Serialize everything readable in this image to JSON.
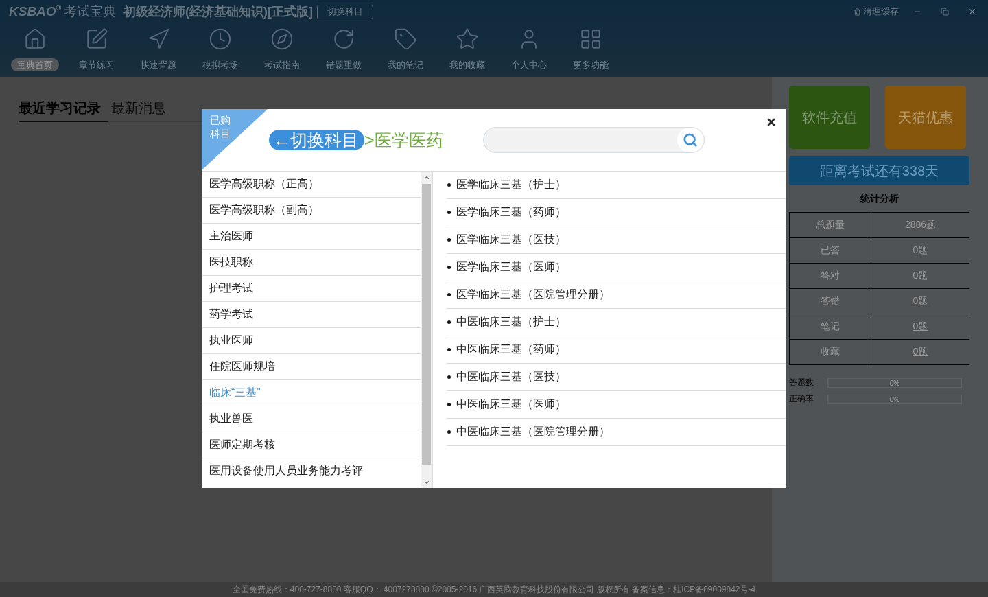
{
  "window": {
    "logo": "KSBAO$^{®}$",
    "brand": "考试宝典",
    "title": "初级经济师(经济基础知识)[正式版]",
    "switch_button": "切换科目",
    "clear_cache": "清理缓存"
  },
  "nav": [
    {
      "label": "宝典首页",
      "selected": true
    },
    {
      "label": "章节练习",
      "selected": false
    },
    {
      "label": "快速背题",
      "selected": false
    },
    {
      "label": "模拟考场",
      "selected": false
    },
    {
      "label": "考试指南",
      "selected": false
    },
    {
      "label": "错题重做",
      "selected": false
    },
    {
      "label": "我的笔记",
      "selected": false
    },
    {
      "label": "我的收藏",
      "selected": false
    },
    {
      "label": "个人中心",
      "selected": false
    },
    {
      "label": "更多功能",
      "selected": false
    }
  ],
  "main_tabs": [
    {
      "label": "最近学习记录",
      "selected": true
    },
    {
      "label": "最新消息",
      "selected": false
    }
  ],
  "side_panel": {
    "actions": [
      {
        "label": "软件充值",
        "color": "#2c5512"
      },
      {
        "label": "天猫优惠",
        "color": "#85560b"
      }
    ],
    "countdown": "距离考试还有338天",
    "stats_title": "统计分析",
    "stats": [
      {
        "label": "总题量",
        "value": "2886题",
        "link": false
      },
      {
        "label": "已答",
        "value": "0题",
        "link": false
      },
      {
        "label": "答对",
        "value": "0题",
        "link": false
      },
      {
        "label": "答错",
        "value": "0题",
        "link": true
      },
      {
        "label": "笔记",
        "value": "0题",
        "link": true
      },
      {
        "label": "收藏",
        "value": "0题",
        "link": true
      }
    ],
    "progress": [
      {
        "label": "答题数",
        "level": 0,
        "reading": "0%"
      },
      {
        "label": "正确率",
        "level": 0,
        "reading": "0%"
      }
    ]
  },
  "dialog": {
    "badge": "已购科目",
    "back_button": "←切换科目",
    "category": ">医学医药",
    "categories": [
      {
        "label": "医学高级职称（正高）",
        "selected": false
      },
      {
        "label": "医学高级职称（副高）",
        "selected": false
      },
      {
        "label": "主治医师",
        "selected": false
      },
      {
        "label": "医技职称",
        "selected": false
      },
      {
        "label": "护理考试",
        "selected": false
      },
      {
        "label": "药学考试",
        "selected": false
      },
      {
        "label": "执业医师",
        "selected": false
      },
      {
        "label": "住院医师规培",
        "selected": false
      },
      {
        "label": "临床“三基”",
        "selected": true
      },
      {
        "label": "执业兽医",
        "selected": false
      },
      {
        "label": "医师定期考核",
        "selected": false
      },
      {
        "label": "医用设备使用人员业务能力考评",
        "selected": false
      }
    ],
    "subjects": [
      "医学临床三基（护士）",
      "医学临床三基（药师）",
      "医学临床三基（医技）",
      "医学临床三基（医师）",
      "医学临床三基（医院管理分册）",
      "中医临床三基（护士）",
      "中医临床三基（药师）",
      "中医临床三基（医技）",
      "中医临床三基（医师）",
      "中医临床三基（医院管理分册）"
    ]
  },
  "footer": "全国免费热线：400-727-8800 客服QQ： 4007278800 ©2005-2016 广西英腾教育科技股份有限公司 版权所有 备案信息：桂ICP备09009842号-4"
}
